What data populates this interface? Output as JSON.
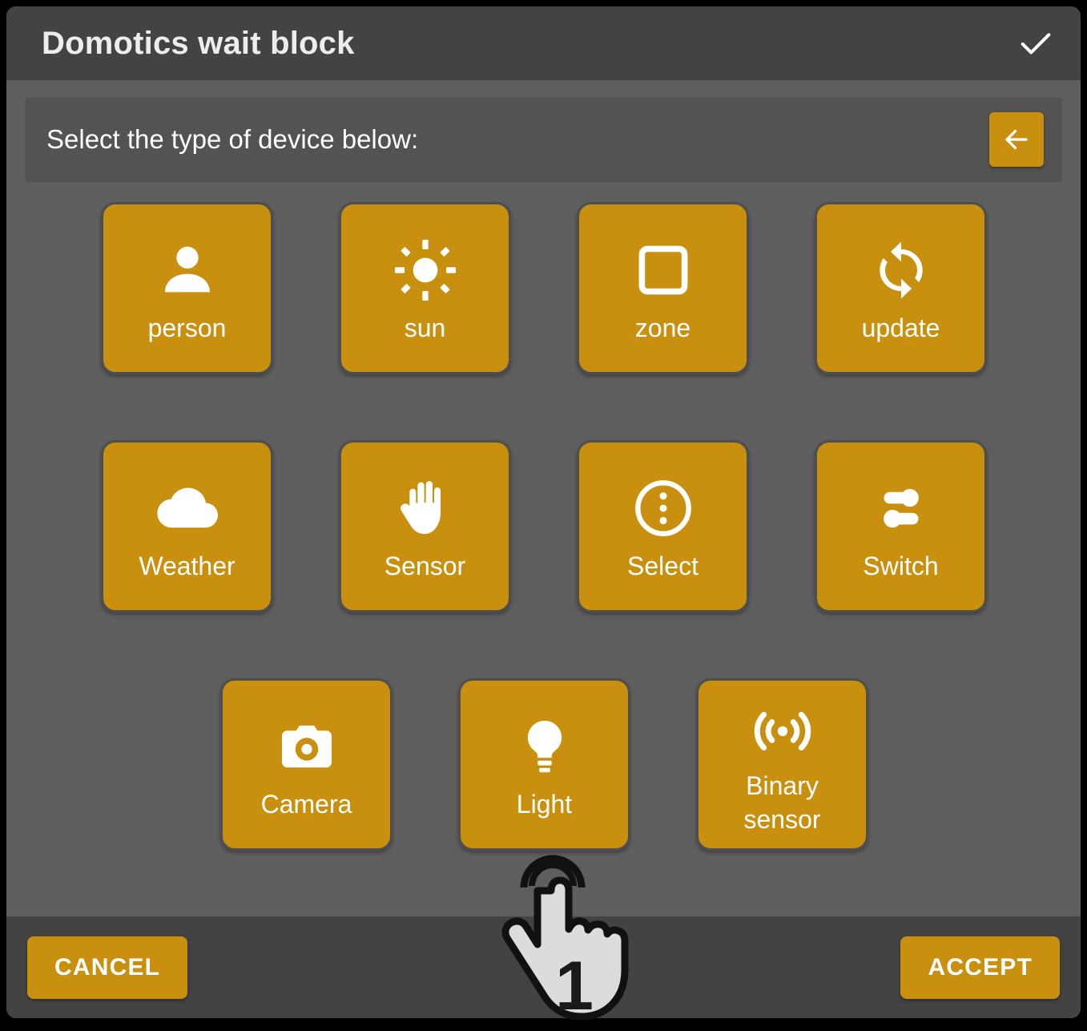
{
  "window": {
    "title": "Domotics wait block",
    "confirm_icon": "check-icon"
  },
  "instruction": {
    "text": "Select the type of device below:",
    "back_icon": "arrow-left-icon"
  },
  "colors": {
    "accent": "#c8900e",
    "titlebar": "#434343",
    "content": "#5e5e5e",
    "panel": "#535353",
    "tile_border": "#4e4e4e",
    "text": "#ffffff"
  },
  "device_rows": [
    [
      {
        "label": "person",
        "icon": "person-icon"
      },
      {
        "label": "sun",
        "icon": "sun-icon"
      },
      {
        "label": "zone",
        "icon": "square-outline-icon"
      },
      {
        "label": "update",
        "icon": "sync-icon"
      }
    ],
    [
      {
        "label": "Weather",
        "icon": "cloud-icon"
      },
      {
        "label": "Sensor",
        "icon": "hand-icon"
      },
      {
        "label": "Select",
        "icon": "dots-vertical-circle-icon"
      },
      {
        "label": "Switch",
        "icon": "toggle-switch-icon"
      }
    ],
    [
      {
        "label": "Camera",
        "icon": "camera-icon"
      },
      {
        "label": "Light",
        "icon": "lightbulb-icon"
      },
      {
        "label": "Binary\nsensor",
        "icon": "radio-waves-icon"
      }
    ]
  ],
  "footer": {
    "cancel_label": "CANCEL",
    "accept_label": "ACCEPT"
  },
  "cursor": {
    "step_number": "1",
    "icon": "hand-pointer-icon"
  }
}
